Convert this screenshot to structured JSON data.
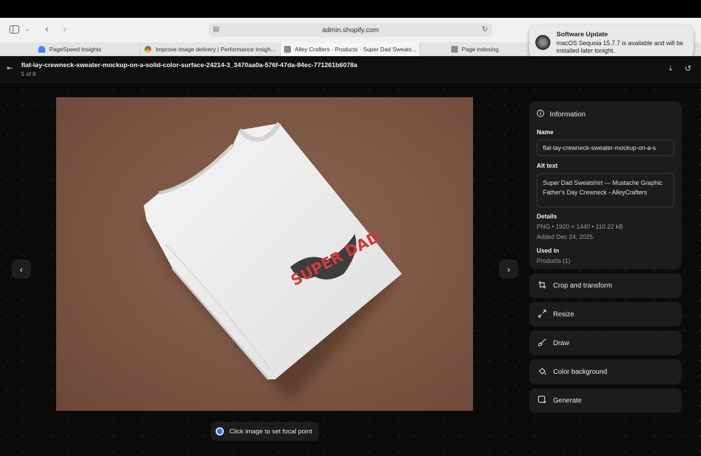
{
  "browser": {
    "url": "admin.shopify.com",
    "tabs": [
      {
        "label": "PageSpeed Insights",
        "fav_color": "#4285f4"
      },
      {
        "label": "Improve image delivery  |  Performance insigh...",
        "fav_color": "#34a853"
      },
      {
        "label": "Alley Crafters · Products · Super Dad Sweats...",
        "fav_color": "#7a7a7a"
      },
      {
        "label": "Page indexing",
        "fav_color": "#8a8a8a"
      }
    ]
  },
  "notification": {
    "title": "Software Update",
    "message": "macOS Sequoia 15.7.7 is available and will be installed later tonight."
  },
  "app": {
    "filename": "flat-lay-crewneck-sweater-mockup-on-a-solid-color-surface-24214-3_3470aa0a-576f-47da-84ec-771261b6078a",
    "position": "5 of 8"
  },
  "image": {
    "print_text": "SUPER DAD",
    "photo_bg": "#7a5443"
  },
  "focal_hint": "Click image to set focal point",
  "info": {
    "heading": "Information",
    "name_label": "Name",
    "name_value": "flat-lay-crewneck-sweater-mockup-on-a-s",
    "alt_label": "Alt text",
    "alt_value": "Super Dad Sweatshirt — Mustache Graphic Father's Day Crewneck - AlleyCrafters",
    "details_label": "Details",
    "details_value": "PNG • 1920 × 1440 • 110.22 kB",
    "added_value": "Added Dec 24, 2025",
    "used_label": "Used in",
    "used_value": "Products (1)"
  },
  "actions": [
    {
      "label": "Crop and transform",
      "icon": "crop-icon"
    },
    {
      "label": "Resize",
      "icon": "resize-icon"
    },
    {
      "label": "Draw",
      "icon": "brush-icon"
    },
    {
      "label": "Color background",
      "icon": "paint-bucket-icon"
    },
    {
      "label": "Generate",
      "icon": "sparkle-image-icon"
    }
  ]
}
